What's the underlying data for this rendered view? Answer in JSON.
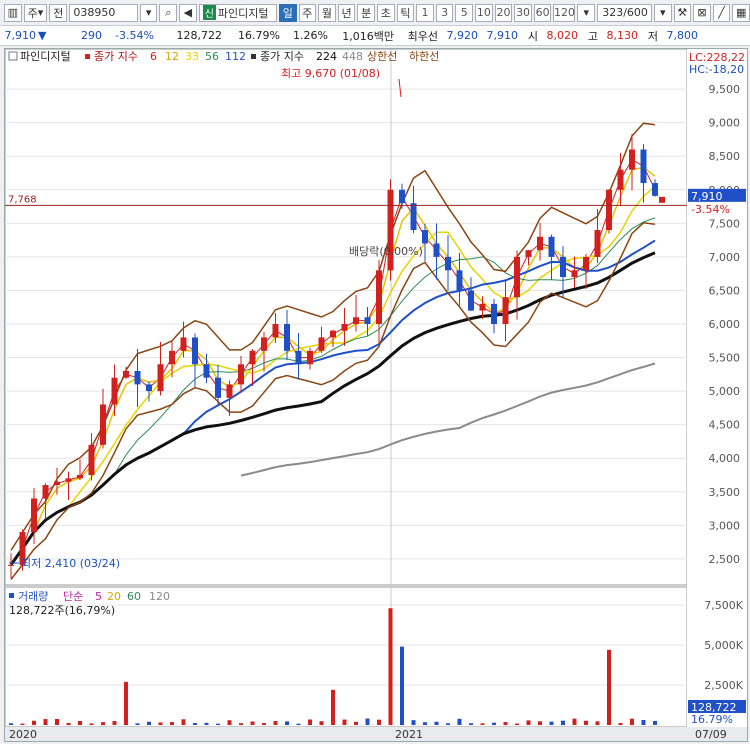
{
  "toolbar": {
    "market": "주",
    "type": "전",
    "code": "038950",
    "badge": "신",
    "stock_name": "파인디지털",
    "periods": [
      "일",
      "주",
      "월",
      "년",
      "분",
      "초",
      "틱"
    ],
    "selected_period": "일",
    "intervals": [
      "1",
      "3",
      "5",
      "10",
      "20",
      "30",
      "60",
      "120"
    ],
    "count": "323/600"
  },
  "quote": {
    "price": "7,910",
    "change": "290",
    "change_pct": "-3.54%",
    "volume": "128,722",
    "vol_ratio": "16.79%",
    "turnover_pct": "1.26%",
    "amount": "1,016백만",
    "min_label": "최우선",
    "ask": "7,920",
    "bid": "7,910",
    "open_label": "시",
    "open": "8,020",
    "high_label": "고",
    "high": "8,130",
    "low_label": "저",
    "low": "7,800"
  },
  "price_panel": {
    "legend_name": "파인디지털",
    "ma_label": "종가 지수",
    "ma_periods": [
      "6",
      "12",
      "33",
      "56",
      "112"
    ],
    "ma_colors": [
      "#d2201e",
      "#e8c400",
      "#e8d400",
      "#2e8b57",
      "#2050c8"
    ],
    "ma2_label": "종가 지수",
    "ma2_periods": [
      "224",
      "448"
    ],
    "upper_label": "상한선",
    "lower_label": "하한선",
    "lc": "LC:228,22",
    "hc": "HC:-18,20",
    "high_note": "최고 9,670 (01/08)",
    "low_note": "최저 2,410 (03/24)",
    "dividend_note": "배당락(0.00%)",
    "hline_label": "7,768",
    "last_price": "7,910",
    "last_pct": "-3.54%"
  },
  "volume_panel": {
    "legend_label": "거래량",
    "ma_label": "단순",
    "ma_periods": [
      "5",
      "20",
      "60",
      "120"
    ],
    "current": "128,722주(16,79%)",
    "last_value": "128,722",
    "last_pct": "16.79%"
  },
  "x_axis": [
    "2020",
    "2021",
    "07/09"
  ],
  "chart_data": {
    "type": "candlestick",
    "y_ticks": [
      "9,500",
      "9,000",
      "8,500",
      "8,000",
      "7,500",
      "7,000",
      "6,500",
      "6,000",
      "5,500",
      "5,000",
      "4,500",
      "4,000",
      "3,500",
      "3,000",
      "2,500"
    ],
    "ylim": [
      2200,
      9800
    ],
    "vol_ticks": [
      "7,500K",
      "5,000K",
      "2,500K"
    ],
    "vol_ylim": [
      0,
      8000
    ],
    "close_approx": [
      2410,
      2900,
      3400,
      3600,
      3650,
      3700,
      3750,
      4200,
      4800,
      5200,
      5300,
      5100,
      5000,
      5400,
      5600,
      5800,
      5400,
      5200,
      4900,
      5100,
      5400,
      5600,
      5800,
      6000,
      5600,
      5400,
      5600,
      5800,
      5900,
      6000,
      6100,
      6000,
      6800,
      8000,
      7800,
      7400,
      7200,
      7000,
      6800,
      6500,
      6200,
      6300,
      6000,
      6400,
      7000,
      7100,
      7300,
      7000,
      6700,
      6800,
      7000,
      7400,
      8000,
      8300,
      8600,
      8100,
      7910
    ],
    "series": [
      {
        "name": "최고",
        "value": 9670
      },
      {
        "name": "최저",
        "value": 2410
      }
    ]
  }
}
